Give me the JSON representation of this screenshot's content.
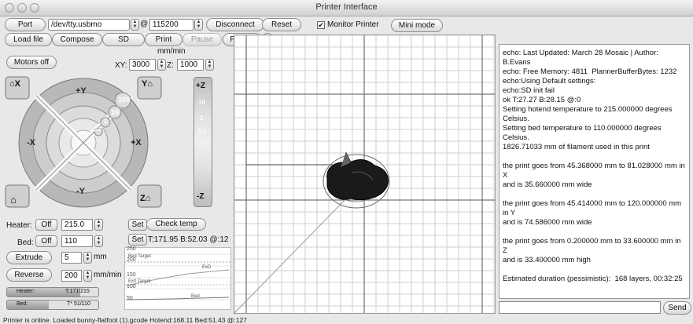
{
  "window": {
    "title": "Printer Interface"
  },
  "toolbar1": {
    "port_label": "Port",
    "port_value": "/dev/tty.usbmo",
    "at_symbol": "@",
    "baud_value": "115200",
    "disconnect_label": "Disconnect",
    "reset_label": "Reset",
    "monitor_label": "Monitor Printer",
    "monitor_checked": true,
    "mini_mode_label": "Mini mode"
  },
  "toolbar2": {
    "load_file_label": "Load file",
    "compose_label": "Compose",
    "sd_label": "SD",
    "print_label": "Print",
    "pause_label": "Pause",
    "fan_label": "Fan on"
  },
  "motion": {
    "motors_off_label": "Motors off",
    "feed_unit": "mm/min",
    "xy_label": "XY:",
    "xy_value": "3000",
    "z_label": "Z:",
    "z_value": "1000",
    "jog_home_x": "X",
    "jog_home_y": "Y",
    "jog_home_z": "Z",
    "jog_plus_y": "+Y",
    "jog_minus_y": "-Y",
    "jog_plus_x": "+X",
    "jog_minus_x": "-X",
    "ring_100": "100",
    "ring_10": "10",
    "ring_1": "1",
    "ring_01": "0.1",
    "z_plus": "+Z",
    "z_minus": "-Z",
    "z_10": "10",
    "z_1": "1",
    "z_01": "0.1"
  },
  "temps": {
    "heater_label": "Heater:",
    "heater_btn": "Off",
    "heater_value": "215.0",
    "bed_label": "Bed:",
    "bed_btn": "Off",
    "bed_value": "110",
    "set_label": "Set",
    "check_temp_label": "Check temp",
    "set2_label": "Set",
    "readout": "T:171.95 B:52.03 @:12"
  },
  "extrude": {
    "extrude_label": "Extrude",
    "extrude_value": "5",
    "extrude_unit": "mm",
    "reverse_label": "Reverse",
    "reverse_value": "200",
    "reverse_unit": "mm/min"
  },
  "gauges": {
    "heater_label": "Heater:",
    "heater_text": "T:171/215",
    "heater_fraction": 0.8,
    "bed_label": "Bed:",
    "bed_text": "T* 51/110",
    "bed_fraction": 0.46
  },
  "graph": {
    "ticks": [
      "250",
      "200",
      "150",
      "100",
      "50"
    ],
    "bed_target_label": "Bed Target",
    "exd_label": "ExD",
    "ex_target_label": "Ex0 Target",
    "bed_label": "Bed"
  },
  "log": {
    "lines": [
      "echo: Last Updated: March 28 Mosaic | Author: B.Evans",
      "echo: Free Memory: 4811  PlannerBufferBytes: 1232",
      "echo:Using Default settings:",
      "echo:SD init fail",
      "ok T:27.27 B:28.15 @:0",
      "Setting hotend temperature to 215.000000 degrees Celsius.",
      "Setting bed temperature to 110.000000 degrees Celsius.",
      "1826.71033 mm of filament used in this print",
      "",
      "the print goes from 45.368000 mm to 81.028000 mm in X",
      "and is 35.660000 mm wide",
      "",
      "the print goes from 45.414000 mm to 120.000000 mm in Y",
      "and is 74.586000 mm wide",
      "",
      "the print goes from 0.200000 mm to 33.600000 mm in Z",
      "and is 33.400000 mm high",
      "",
      "Estimated duration (pessimistic):  168 layers, 00:32:25"
    ],
    "send_label": "Send",
    "command_value": ""
  },
  "status": {
    "text": "Printer is online. Loaded bunny-flatfoot (1).gcode Hotend:168.11 Bed:51.43 @:127"
  },
  "colors": {
    "accent": "#3b6fd1",
    "grid_minor": "#cfcfcf",
    "grid_major": "#555555",
    "model": "#1a1a1a"
  }
}
